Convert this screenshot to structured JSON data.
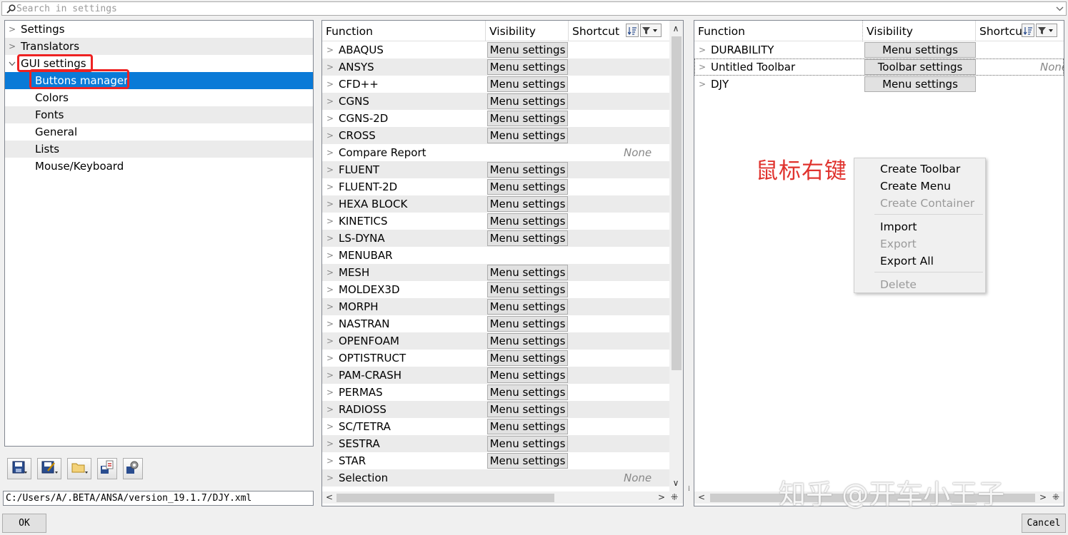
{
  "search": {
    "placeholder": "Search in settings"
  },
  "tree": {
    "items": [
      {
        "label": "Settings"
      },
      {
        "label": "Translators"
      },
      {
        "label": "GUI settings"
      },
      {
        "label": "Buttons manager"
      },
      {
        "label": "Colors"
      },
      {
        "label": "Fonts"
      },
      {
        "label": "General"
      },
      {
        "label": "Lists"
      },
      {
        "label": "Mouse/Keyboard"
      }
    ]
  },
  "bottom_toolbar": {
    "icons": [
      "save-icon",
      "save-as-icon",
      "open-folder-icon",
      "export-icon",
      "settings-gear-icon"
    ]
  },
  "path_field": {
    "value": "C:/Users/A/.BETA/ANSA/version_19.1.7/DJY.xml"
  },
  "middle_table": {
    "headers": {
      "function": "Function",
      "visibility": "Visibility",
      "shortcut": "Shortcut"
    },
    "rows": [
      {
        "name": "ABAQUS",
        "button": "Menu settings",
        "shortcut": ""
      },
      {
        "name": "ANSYS",
        "button": "Menu settings",
        "shortcut": ""
      },
      {
        "name": "CFD++",
        "button": "Menu settings",
        "shortcut": ""
      },
      {
        "name": "CGNS",
        "button": "Menu settings",
        "shortcut": ""
      },
      {
        "name": "CGNS-2D",
        "button": "Menu settings",
        "shortcut": ""
      },
      {
        "name": "CROSS",
        "button": "Menu settings",
        "shortcut": ""
      },
      {
        "name": "Compare Report",
        "button": "",
        "shortcut": "None"
      },
      {
        "name": "FLUENT",
        "button": "Menu settings",
        "shortcut": ""
      },
      {
        "name": "FLUENT-2D",
        "button": "Menu settings",
        "shortcut": ""
      },
      {
        "name": "HEXA BLOCK",
        "button": "Menu settings",
        "shortcut": ""
      },
      {
        "name": "KINETICS",
        "button": "Menu settings",
        "shortcut": ""
      },
      {
        "name": "LS-DYNA",
        "button": "Menu settings",
        "shortcut": ""
      },
      {
        "name": "MENUBAR",
        "button": "",
        "shortcut": ""
      },
      {
        "name": "MESH",
        "button": "Menu settings",
        "shortcut": ""
      },
      {
        "name": "MOLDEX3D",
        "button": "Menu settings",
        "shortcut": ""
      },
      {
        "name": "MORPH",
        "button": "Menu settings",
        "shortcut": ""
      },
      {
        "name": "NASTRAN",
        "button": "Menu settings",
        "shortcut": ""
      },
      {
        "name": "OPENFOAM",
        "button": "Menu settings",
        "shortcut": ""
      },
      {
        "name": "OPTISTRUCT",
        "button": "Menu settings",
        "shortcut": ""
      },
      {
        "name": "PAM-CRASH",
        "button": "Menu settings",
        "shortcut": ""
      },
      {
        "name": "PERMAS",
        "button": "Menu settings",
        "shortcut": ""
      },
      {
        "name": "RADIOSS",
        "button": "Menu settings",
        "shortcut": ""
      },
      {
        "name": "SC/TETRA",
        "button": "Menu settings",
        "shortcut": ""
      },
      {
        "name": "SESTRA",
        "button": "Menu settings",
        "shortcut": ""
      },
      {
        "name": "STAR",
        "button": "Menu settings",
        "shortcut": ""
      },
      {
        "name": "Selection",
        "button": "",
        "shortcut": "None"
      }
    ]
  },
  "right_table": {
    "headers": {
      "function": "Function",
      "visibility": "Visibility",
      "shortcut": "Shortcu"
    },
    "rows": [
      {
        "name": "DURABILITY",
        "button": "Menu settings",
        "shortcut": ""
      },
      {
        "name": "Untitled Toolbar",
        "button": "Toolbar settings",
        "shortcut": "None"
      },
      {
        "name": "DJY",
        "button": "Menu settings",
        "shortcut": ""
      }
    ]
  },
  "context_menu": {
    "items": [
      {
        "label": "Create Toolbar",
        "enabled": true
      },
      {
        "label": "Create Menu",
        "enabled": true
      },
      {
        "label": "Create Container",
        "enabled": false
      },
      {
        "label": "Import",
        "enabled": true
      },
      {
        "label": "Export",
        "enabled": false
      },
      {
        "label": "Export All",
        "enabled": true
      },
      {
        "label": "Delete",
        "enabled": false
      }
    ]
  },
  "annotation": {
    "text": "鼠标右键",
    "color": "#e0332e"
  },
  "watermark": {
    "text": "知乎 @开车小王子"
  },
  "dialog": {
    "ok": "OK",
    "cancel": "Cancel"
  },
  "colors": {
    "selection": "#0a7ad7",
    "highlight_box": "#e22222"
  }
}
